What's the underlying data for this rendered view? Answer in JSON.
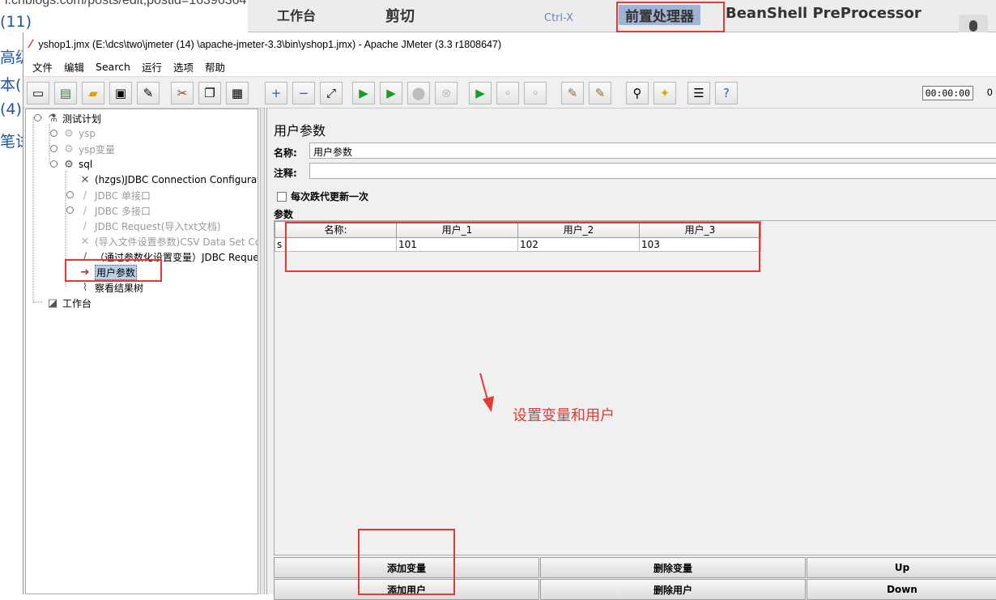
{
  "browser": {
    "url": "i.cnblogs.com/posts/edit;postid=16396364",
    "side_texts": [
      "(11)",
      "高级",
      "本(",
      "(4)",
      "笔试"
    ],
    "strip": {
      "tab_label": "工作台",
      "cut": "剪切",
      "shortcut": "Ctrl-X",
      "preprocessor": "前置处理器",
      "beanshell": "BeanShell PreProcessor"
    }
  },
  "window": {
    "title": "yshop1.jmx (E:\\dcs\\two\\jmeter  (14)  \\apache-jmeter-3.3\\bin\\yshop1.jmx) - Apache JMeter (3.3 r1808647)"
  },
  "menu": [
    "文件",
    "编辑",
    "Search",
    "运行",
    "选项",
    "帮助"
  ],
  "toolbar": {
    "buttons": [
      {
        "name": "new-icon",
        "glyph": "▭"
      },
      {
        "name": "templates-icon",
        "glyph": "▤"
      },
      {
        "name": "open-icon",
        "glyph": "▰"
      },
      {
        "name": "save-icon",
        "glyph": "▣"
      },
      {
        "name": "save-as-icon",
        "glyph": "✎"
      },
      {
        "name": "cut-icon",
        "glyph": "✂"
      },
      {
        "name": "copy-icon",
        "glyph": "❐"
      },
      {
        "name": "paste-icon",
        "glyph": "▦"
      },
      {
        "name": "expand-icon",
        "glyph": "+"
      },
      {
        "name": "collapse-icon",
        "glyph": "−"
      },
      {
        "name": "toggle-icon",
        "glyph": "⤢"
      },
      {
        "name": "start-icon",
        "glyph": "▶"
      },
      {
        "name": "start-no-pause-icon",
        "glyph": "▶"
      },
      {
        "name": "stop-icon",
        "glyph": "⬤"
      },
      {
        "name": "shutdown-icon",
        "glyph": "⊗"
      },
      {
        "name": "remote-start-icon",
        "glyph": "▶"
      },
      {
        "name": "remote-stop-icon",
        "glyph": "⚬"
      },
      {
        "name": "remote-shutdown-icon",
        "glyph": "⚬"
      },
      {
        "name": "clear-icon",
        "glyph": "✎"
      },
      {
        "name": "clear-all-icon",
        "glyph": "✎"
      },
      {
        "name": "search-icon",
        "glyph": "⚲"
      },
      {
        "name": "reset-search-icon",
        "glyph": "✦"
      },
      {
        "name": "function-helper-icon",
        "glyph": "☰"
      },
      {
        "name": "help-icon",
        "glyph": "?"
      }
    ],
    "timer": "00:00:00",
    "count": "0"
  },
  "tree": {
    "nodes": [
      {
        "label": "测试计划",
        "icon": "flask-icon",
        "glyph": "⚗",
        "state": "normal"
      },
      {
        "label": "ysp",
        "icon": "gear-icon",
        "glyph": "⚙",
        "state": "disabled"
      },
      {
        "label": "ysp变量",
        "icon": "gear-icon",
        "glyph": "⚙",
        "state": "disabled"
      },
      {
        "label": "sql",
        "icon": "gear-icon",
        "glyph": "⚙",
        "state": "normal"
      },
      {
        "label": "(hzgs)JDBC Connection Configuratio",
        "icon": "wrench-icon",
        "glyph": "✕",
        "state": "normal"
      },
      {
        "label": "JDBC 单接口",
        "icon": "pipette-icon",
        "glyph": "∕",
        "state": "disabled"
      },
      {
        "label": "JDBC 多接口",
        "icon": "pipette-icon",
        "glyph": "∕",
        "state": "disabled"
      },
      {
        "label": "JDBC Request(导入txt文档)",
        "icon": "pipette-icon",
        "glyph": "∕",
        "state": "disabled"
      },
      {
        "label": "(导入文件设置参数)CSV Data Set Cor",
        "icon": "wrench-icon",
        "glyph": "✕",
        "state": "disabled"
      },
      {
        "label": "（通过参数化设置变量）JDBC Reque",
        "icon": "pipette-icon",
        "glyph": "∕",
        "state": "normal"
      },
      {
        "label": "用户参数",
        "icon": "preprocessor-icon",
        "glyph": "➔",
        "state": "selected"
      },
      {
        "label": "察看结果树",
        "icon": "listener-icon",
        "glyph": "⌇",
        "state": "normal"
      },
      {
        "label": "工作台",
        "icon": "workbench-icon",
        "glyph": "◪",
        "state": "normal"
      }
    ]
  },
  "panel": {
    "title": "用户参数",
    "name_label": "名称:",
    "name_value": "用户参数",
    "comment_label": "注释:",
    "comment_value": "",
    "checkbox_label": "每次跌代更新一次",
    "params_label": "参数",
    "table": {
      "headers": [
        "名称:",
        "用户_1",
        "用户_2",
        "用户_3"
      ],
      "rows": [
        [
          "s",
          "101",
          "102",
          "103"
        ]
      ]
    },
    "annotation": "设置变量和用户",
    "buttons": {
      "add_var": "添加变量",
      "del_var": "删除变量",
      "up": "Up",
      "add_user": "添加用户",
      "del_user": "删除用户",
      "down": "Down"
    }
  },
  "colors": {
    "highlight": "#e53935",
    "selection": "#b8cfe5",
    "link_blue": "#1a56a8"
  }
}
